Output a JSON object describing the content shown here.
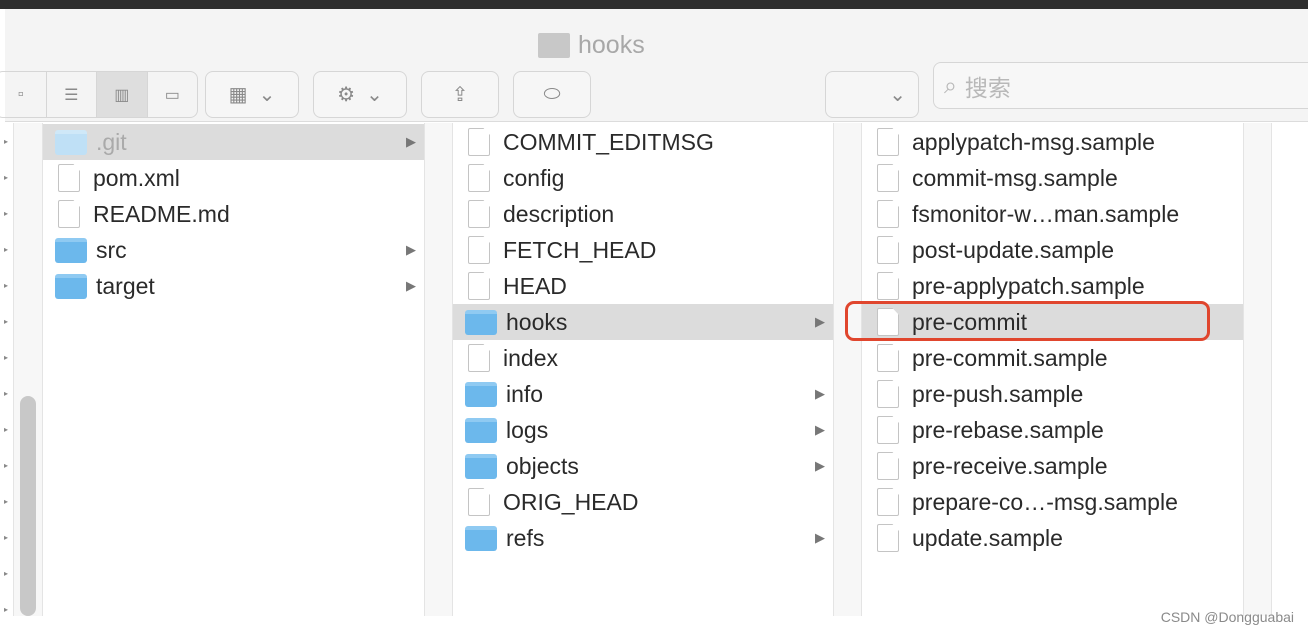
{
  "window": {
    "title": "hooks"
  },
  "toolbar": {
    "search_placeholder": "搜索",
    "view_modes": [
      "icon",
      "list",
      "column",
      "gallery"
    ],
    "active_view": "column"
  },
  "columns": [
    [
      {
        "name": ".git",
        "type": "folder",
        "selected": true,
        "children": true,
        "dim": true
      },
      {
        "name": "pom.xml",
        "type": "file"
      },
      {
        "name": "README.md",
        "type": "file"
      },
      {
        "name": "src",
        "type": "folder",
        "children": true
      },
      {
        "name": "target",
        "type": "folder",
        "children": true
      }
    ],
    [
      {
        "name": "COMMIT_EDITMSG",
        "type": "file"
      },
      {
        "name": "config",
        "type": "file"
      },
      {
        "name": "description",
        "type": "file"
      },
      {
        "name": "FETCH_HEAD",
        "type": "file"
      },
      {
        "name": "HEAD",
        "type": "file"
      },
      {
        "name": "hooks",
        "type": "folder",
        "selected": true,
        "children": true
      },
      {
        "name": "index",
        "type": "file"
      },
      {
        "name": "info",
        "type": "folder",
        "children": true
      },
      {
        "name": "logs",
        "type": "folder",
        "children": true
      },
      {
        "name": "objects",
        "type": "folder",
        "children": true
      },
      {
        "name": "ORIG_HEAD",
        "type": "file"
      },
      {
        "name": "refs",
        "type": "folder",
        "children": true
      }
    ],
    [
      {
        "name": "applypatch-msg.sample",
        "type": "file"
      },
      {
        "name": "commit-msg.sample",
        "type": "file"
      },
      {
        "name": "fsmonitor-w…man.sample",
        "type": "file"
      },
      {
        "name": "post-update.sample",
        "type": "file"
      },
      {
        "name": "pre-applypatch.sample",
        "type": "file"
      },
      {
        "name": "pre-commit",
        "type": "file",
        "selected": true,
        "highlighted": true
      },
      {
        "name": "pre-commit.sample",
        "type": "file"
      },
      {
        "name": "pre-push.sample",
        "type": "file"
      },
      {
        "name": "pre-rebase.sample",
        "type": "file"
      },
      {
        "name": "pre-receive.sample",
        "type": "file"
      },
      {
        "name": "prepare-co…-msg.sample",
        "type": "file"
      },
      {
        "name": "update.sample",
        "type": "file"
      }
    ]
  ],
  "highlight_color": "#e0462e",
  "watermark": "CSDN @Dongguabai"
}
